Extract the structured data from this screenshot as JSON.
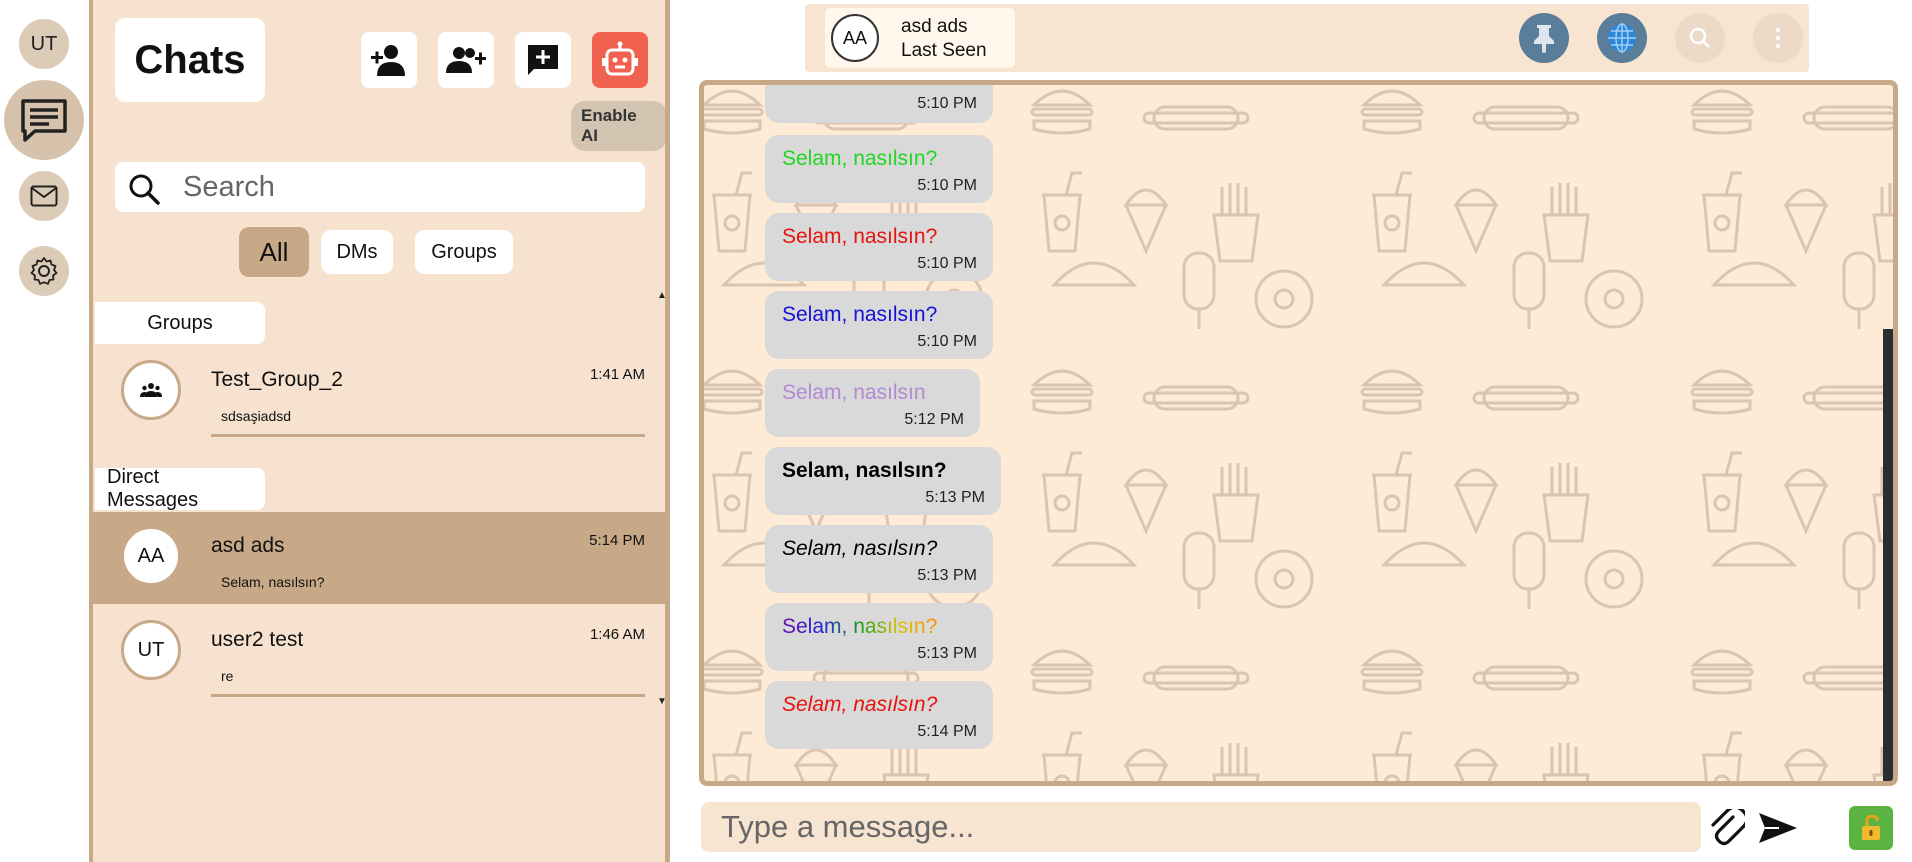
{
  "rail": {
    "avatar_initials": "UT",
    "items": [
      {
        "name": "chats",
        "icon": "chat-bubble-icon",
        "active": true
      },
      {
        "name": "mail",
        "icon": "envelope-icon",
        "active": false
      },
      {
        "name": "settings",
        "icon": "gear-icon",
        "active": false
      }
    ]
  },
  "sidebar": {
    "title": "Chats",
    "actions": [
      {
        "name": "add-contact",
        "icon": "person-add-icon"
      },
      {
        "name": "create-group",
        "icon": "group-add-icon"
      },
      {
        "name": "new-chat",
        "icon": "chat-plus-icon"
      },
      {
        "name": "enable-ai",
        "icon": "robot-icon"
      }
    ],
    "ai_tooltip": "Enable AI",
    "search_placeholder": "Search",
    "filters": [
      "All",
      "DMs",
      "Groups"
    ],
    "active_filter": "All",
    "groups_label": "Groups",
    "groups": [
      {
        "name": "Test_Group_2",
        "time": "1:41 AM",
        "preview": "sdsaşiadsd",
        "avatar_icon": "group-icon"
      }
    ],
    "dm_label": "Direct Messages",
    "dms": [
      {
        "initials": "AA",
        "name": "asd ads",
        "time": "5:14 PM",
        "preview": "Selam, nasılsın?",
        "selected": true
      },
      {
        "initials": "UT",
        "name": "user2 test",
        "time": "1:46 AM",
        "preview": "re",
        "selected": false
      }
    ]
  },
  "chat": {
    "contact_initials": "AA",
    "contact_name": "asd ads",
    "contact_status": "Last Seen",
    "header_buttons": [
      {
        "name": "pin",
        "icon": "pin-icon",
        "color": "#5a7d99"
      },
      {
        "name": "translate",
        "icon": "globe-icon",
        "color": "#5a7d99"
      },
      {
        "name": "search",
        "icon": "search-icon",
        "color": "#ecdac6"
      },
      {
        "name": "more",
        "icon": "more-vertical-icon",
        "color": "#ecdac6"
      }
    ],
    "messages": [
      {
        "text": "",
        "time": "5:10 PM",
        "color": "#000000",
        "style": "normal"
      },
      {
        "text": "Selam, nasılsın?",
        "time": "5:10 PM",
        "color": "#22d622",
        "style": "normal"
      },
      {
        "text": "Selam, nasılsın?",
        "time": "5:10 PM",
        "color": "#e8140c",
        "style": "normal"
      },
      {
        "text": "Selam, nasılsın?",
        "time": "5:10 PM",
        "color": "#1212d8",
        "style": "normal"
      },
      {
        "text": "Selam, nasılsın",
        "time": "5:12 PM",
        "color": "#b18ad4",
        "style": "normal"
      },
      {
        "text": "Selam, nasılsın?",
        "time": "5:13 PM",
        "color": "#000000",
        "style": "bold"
      },
      {
        "text": "Selam, nasılsın?",
        "time": "5:13 PM",
        "color": "#000000",
        "style": "italic"
      },
      {
        "text": "Selam, nasılsın?",
        "time": "5:13 PM",
        "color": "rainbow",
        "style": "normal"
      },
      {
        "text": "Selam, nasılsın?",
        "time": "5:14 PM",
        "color": "#e8140c",
        "style": "italic"
      }
    ],
    "composer_placeholder": "Type a message...",
    "attach_icon": "paperclip-icon",
    "send_icon": "send-icon",
    "lock_icon": "unlock-icon",
    "lock_color": "#5bb441"
  }
}
